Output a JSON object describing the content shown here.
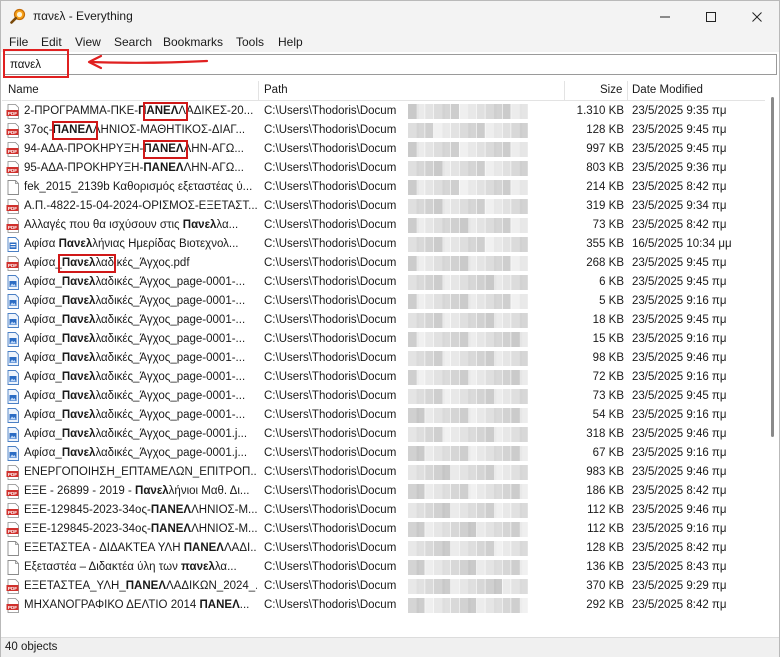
{
  "window": {
    "title": "πανελ - Everything"
  },
  "menu": [
    "File",
    "Edit",
    "View",
    "Search",
    "Bookmarks",
    "Tools",
    "Help"
  ],
  "search": {
    "value": "πανελ"
  },
  "columns": {
    "name": "Name",
    "path": "Path",
    "size": "Size",
    "date": "Date Modified"
  },
  "rows": [
    {
      "icon": "pdf-icon",
      "pre": "2-ΠΡΟΓΡΑΜΜΑ-ΠΚΕ-",
      "hi": "ΠΑΝΕΛ",
      "post": "ΛΑΔΙΚΕΣ-20...",
      "path": "C:\\Users\\Thodoris\\Docum",
      "size": "1.310 KB",
      "date": "23/5/2025 9:35 πμ"
    },
    {
      "icon": "pdf-icon",
      "pre": "37ος-",
      "hi": "ΠΑΝΕΛ",
      "post": "ΛΗΝΙΟΣ-ΜΑΘΗΤΙΚΟΣ-ΔΙΑΓ...",
      "path": "C:\\Users\\Thodoris\\Docum",
      "size": "128 KB",
      "date": "23/5/2025 9:45 πμ"
    },
    {
      "icon": "pdf-icon",
      "pre": "94-ΑΔΑ-ΠΡΟΚΗΡΥΞΗ-",
      "hi": "ΠΑΝΕΛ",
      "post": "ΛΗΝ-ΑΓΩ...",
      "path": "C:\\Users\\Thodoris\\Docum",
      "size": "997 KB",
      "date": "23/5/2025 9:45 πμ"
    },
    {
      "icon": "pdf-icon",
      "pre": "95-ΑΔΑ-ΠΡΟΚΗΡΥΞΗ-",
      "hi": "ΠΑΝΕΛ",
      "post": "ΛΗΝ-ΑΓΩ...",
      "path": "C:\\Users\\Thodoris\\Docum",
      "size": "803 KB",
      "date": "23/5/2025 9:36 πμ"
    },
    {
      "icon": "file-icon",
      "pre": "fek_2015_2139b Καθορισμός εξεταστέας ύ...",
      "hi": "",
      "post": "",
      "path": "C:\\Users\\Thodoris\\Docum",
      "size": "214 KB",
      "date": "23/5/2025 8:42 πμ"
    },
    {
      "icon": "pdf-icon",
      "pre": "Α.Π.-4822-15-04-2024-ΟΡΙΣΜΟΣ-ΕΞΕΤΑΣΤ...",
      "hi": "",
      "post": "",
      "path": "C:\\Users\\Thodoris\\Docum",
      "size": "319 KB",
      "date": "23/5/2025 9:34 πμ"
    },
    {
      "icon": "pdf-icon",
      "pre": "Αλλαγές που θα ισχύσουν στις ",
      "hi": "Πανελ",
      "post": "λα...",
      "path": "C:\\Users\\Thodoris\\Docum",
      "size": "73 KB",
      "date": "23/5/2025 8:42 πμ"
    },
    {
      "icon": "word-icon",
      "pre": "Αφίσα ",
      "hi": "Πανελ",
      "post": "λήνιας Ημερίδας Βιοτεχνολ...",
      "path": "C:\\Users\\Thodoris\\Docum",
      "size": "355 KB",
      "date": "16/5/2025 10:34 μμ"
    },
    {
      "icon": "pdf-icon",
      "pre": "Αφίσα_",
      "hi": "Πανελ",
      "post": "λαδικές_Άγχος.pdf",
      "path": "C:\\Users\\Thodoris\\Docum",
      "size": "268 KB",
      "date": "23/5/2025 9:45 πμ"
    },
    {
      "icon": "image-icon",
      "pre": "Αφίσα_",
      "hi": "Πανελ",
      "post": "λαδικές_Άγχος_page-0001-...",
      "path": "C:\\Users\\Thodoris\\Docum",
      "size": "6 KB",
      "date": "23/5/2025 9:45 πμ"
    },
    {
      "icon": "image-icon",
      "pre": "Αφίσα_",
      "hi": "Πανελ",
      "post": "λαδικές_Άγχος_page-0001-...",
      "path": "C:\\Users\\Thodoris\\Docum",
      "size": "5 KB",
      "date": "23/5/2025 9:16 πμ"
    },
    {
      "icon": "image-icon",
      "pre": "Αφίσα_",
      "hi": "Πανελ",
      "post": "λαδικές_Άγχος_page-0001-...",
      "path": "C:\\Users\\Thodoris\\Docum",
      "size": "18 KB",
      "date": "23/5/2025 9:45 πμ"
    },
    {
      "icon": "image-icon",
      "pre": "Αφίσα_",
      "hi": "Πανελ",
      "post": "λαδικές_Άγχος_page-0001-...",
      "path": "C:\\Users\\Thodoris\\Docum",
      "size": "15 KB",
      "date": "23/5/2025 9:16 πμ"
    },
    {
      "icon": "image-icon",
      "pre": "Αφίσα_",
      "hi": "Πανελ",
      "post": "λαδικές_Άγχος_page-0001-...",
      "path": "C:\\Users\\Thodoris\\Docum",
      "size": "98 KB",
      "date": "23/5/2025 9:46 πμ"
    },
    {
      "icon": "image-icon",
      "pre": "Αφίσα_",
      "hi": "Πανελ",
      "post": "λαδικές_Άγχος_page-0001-...",
      "path": "C:\\Users\\Thodoris\\Docum",
      "size": "72 KB",
      "date": "23/5/2025 9:16 πμ"
    },
    {
      "icon": "image-icon",
      "pre": "Αφίσα_",
      "hi": "Πανελ",
      "post": "λαδικές_Άγχος_page-0001-...",
      "path": "C:\\Users\\Thodoris\\Docum",
      "size": "73 KB",
      "date": "23/5/2025 9:45 πμ"
    },
    {
      "icon": "image-icon",
      "pre": "Αφίσα_",
      "hi": "Πανελ",
      "post": "λαδικές_Άγχος_page-0001-...",
      "path": "C:\\Users\\Thodoris\\Docum",
      "size": "54 KB",
      "date": "23/5/2025 9:16 πμ"
    },
    {
      "icon": "image-icon",
      "pre": "Αφίσα_",
      "hi": "Πανελ",
      "post": "λαδικές_Άγχος_page-0001.j...",
      "path": "C:\\Users\\Thodoris\\Docum",
      "size": "318 KB",
      "date": "23/5/2025 9:46 πμ"
    },
    {
      "icon": "image-icon",
      "pre": "Αφίσα_",
      "hi": "Πανελ",
      "post": "λαδικές_Άγχος_page-0001.j...",
      "path": "C:\\Users\\Thodoris\\Docum",
      "size": "67 KB",
      "date": "23/5/2025 9:16 πμ"
    },
    {
      "icon": "pdf-icon",
      "pre": "ΕΝΕΡΓΟΠΟΙΗΣΗ_ΕΠΤΑΜΕΛΩΝ_ΕΠΙΤΡΟΠ...",
      "hi": "",
      "post": "",
      "path": "C:\\Users\\Thodoris\\Docum",
      "size": "983 KB",
      "date": "23/5/2025 9:46 πμ"
    },
    {
      "icon": "pdf-icon",
      "pre": "ΕΞΕ - 26899 - 2019 - ",
      "hi": "Πανελ",
      "post": "λήνιοι Μαθ. Δι...",
      "path": "C:\\Users\\Thodoris\\Docum",
      "size": "186 KB",
      "date": "23/5/2025 8:42 πμ"
    },
    {
      "icon": "pdf-icon",
      "pre": "ΕΞΕ-129845-2023-34ος-",
      "hi": "ΠΑΝΕΛ",
      "post": "ΛΗΝΙΟΣ-Μ...",
      "path": "C:\\Users\\Thodoris\\Docum",
      "size": "112 KB",
      "date": "23/5/2025 9:46 πμ"
    },
    {
      "icon": "pdf-icon",
      "pre": "ΕΞΕ-129845-2023-34ος-",
      "hi": "ΠΑΝΕΛ",
      "post": "ΛΗΝΙΟΣ-Μ...",
      "path": "C:\\Users\\Thodoris\\Docum",
      "size": "112 KB",
      "date": "23/5/2025 9:16 πμ"
    },
    {
      "icon": "file-icon",
      "pre": "ΕΞΕΤΑΣΤΕΑ - ΔΙΔΑΚΤΕΑ ΥΛΗ ",
      "hi": "ΠΑΝΕΛ",
      "post": "ΛΑΔΙ...",
      "path": "C:\\Users\\Thodoris\\Docum",
      "size": "128 KB",
      "date": "23/5/2025 8:42 πμ"
    },
    {
      "icon": "file-icon",
      "pre": "Εξεταστέα – Διδακτέα ύλη των ",
      "hi": "πανελ",
      "post": "λα...",
      "path": "C:\\Users\\Thodoris\\Docum",
      "size": "136 KB",
      "date": "23/5/2025 8:43 πμ"
    },
    {
      "icon": "pdf-icon",
      "pre": "ΕΞΕΤΑΣΤΕΑ_ΥΛΗ_",
      "hi": "ΠΑΝΕΛ",
      "post": "ΛΑΔΙΚΩΝ_2024_...",
      "path": "C:\\Users\\Thodoris\\Docum",
      "size": "370 KB",
      "date": "23/5/2025 9:29 πμ"
    },
    {
      "icon": "pdf-icon",
      "pre": "ΜΗΧΑΝΟΓΡΑΦΙΚΟ ΔΕΛΤΙΟ 2014 ",
      "hi": "ΠΑΝΕΛ",
      "post": "...",
      "path": "C:\\Users\\Thodoris\\Docum",
      "size": "292 KB",
      "date": "23/5/2025 8:42 πμ"
    }
  ],
  "status": {
    "count": "40 objects"
  },
  "colors": {
    "accent": "#e02020",
    "pdf": "#d0312d",
    "image": "#2b6cc4"
  }
}
